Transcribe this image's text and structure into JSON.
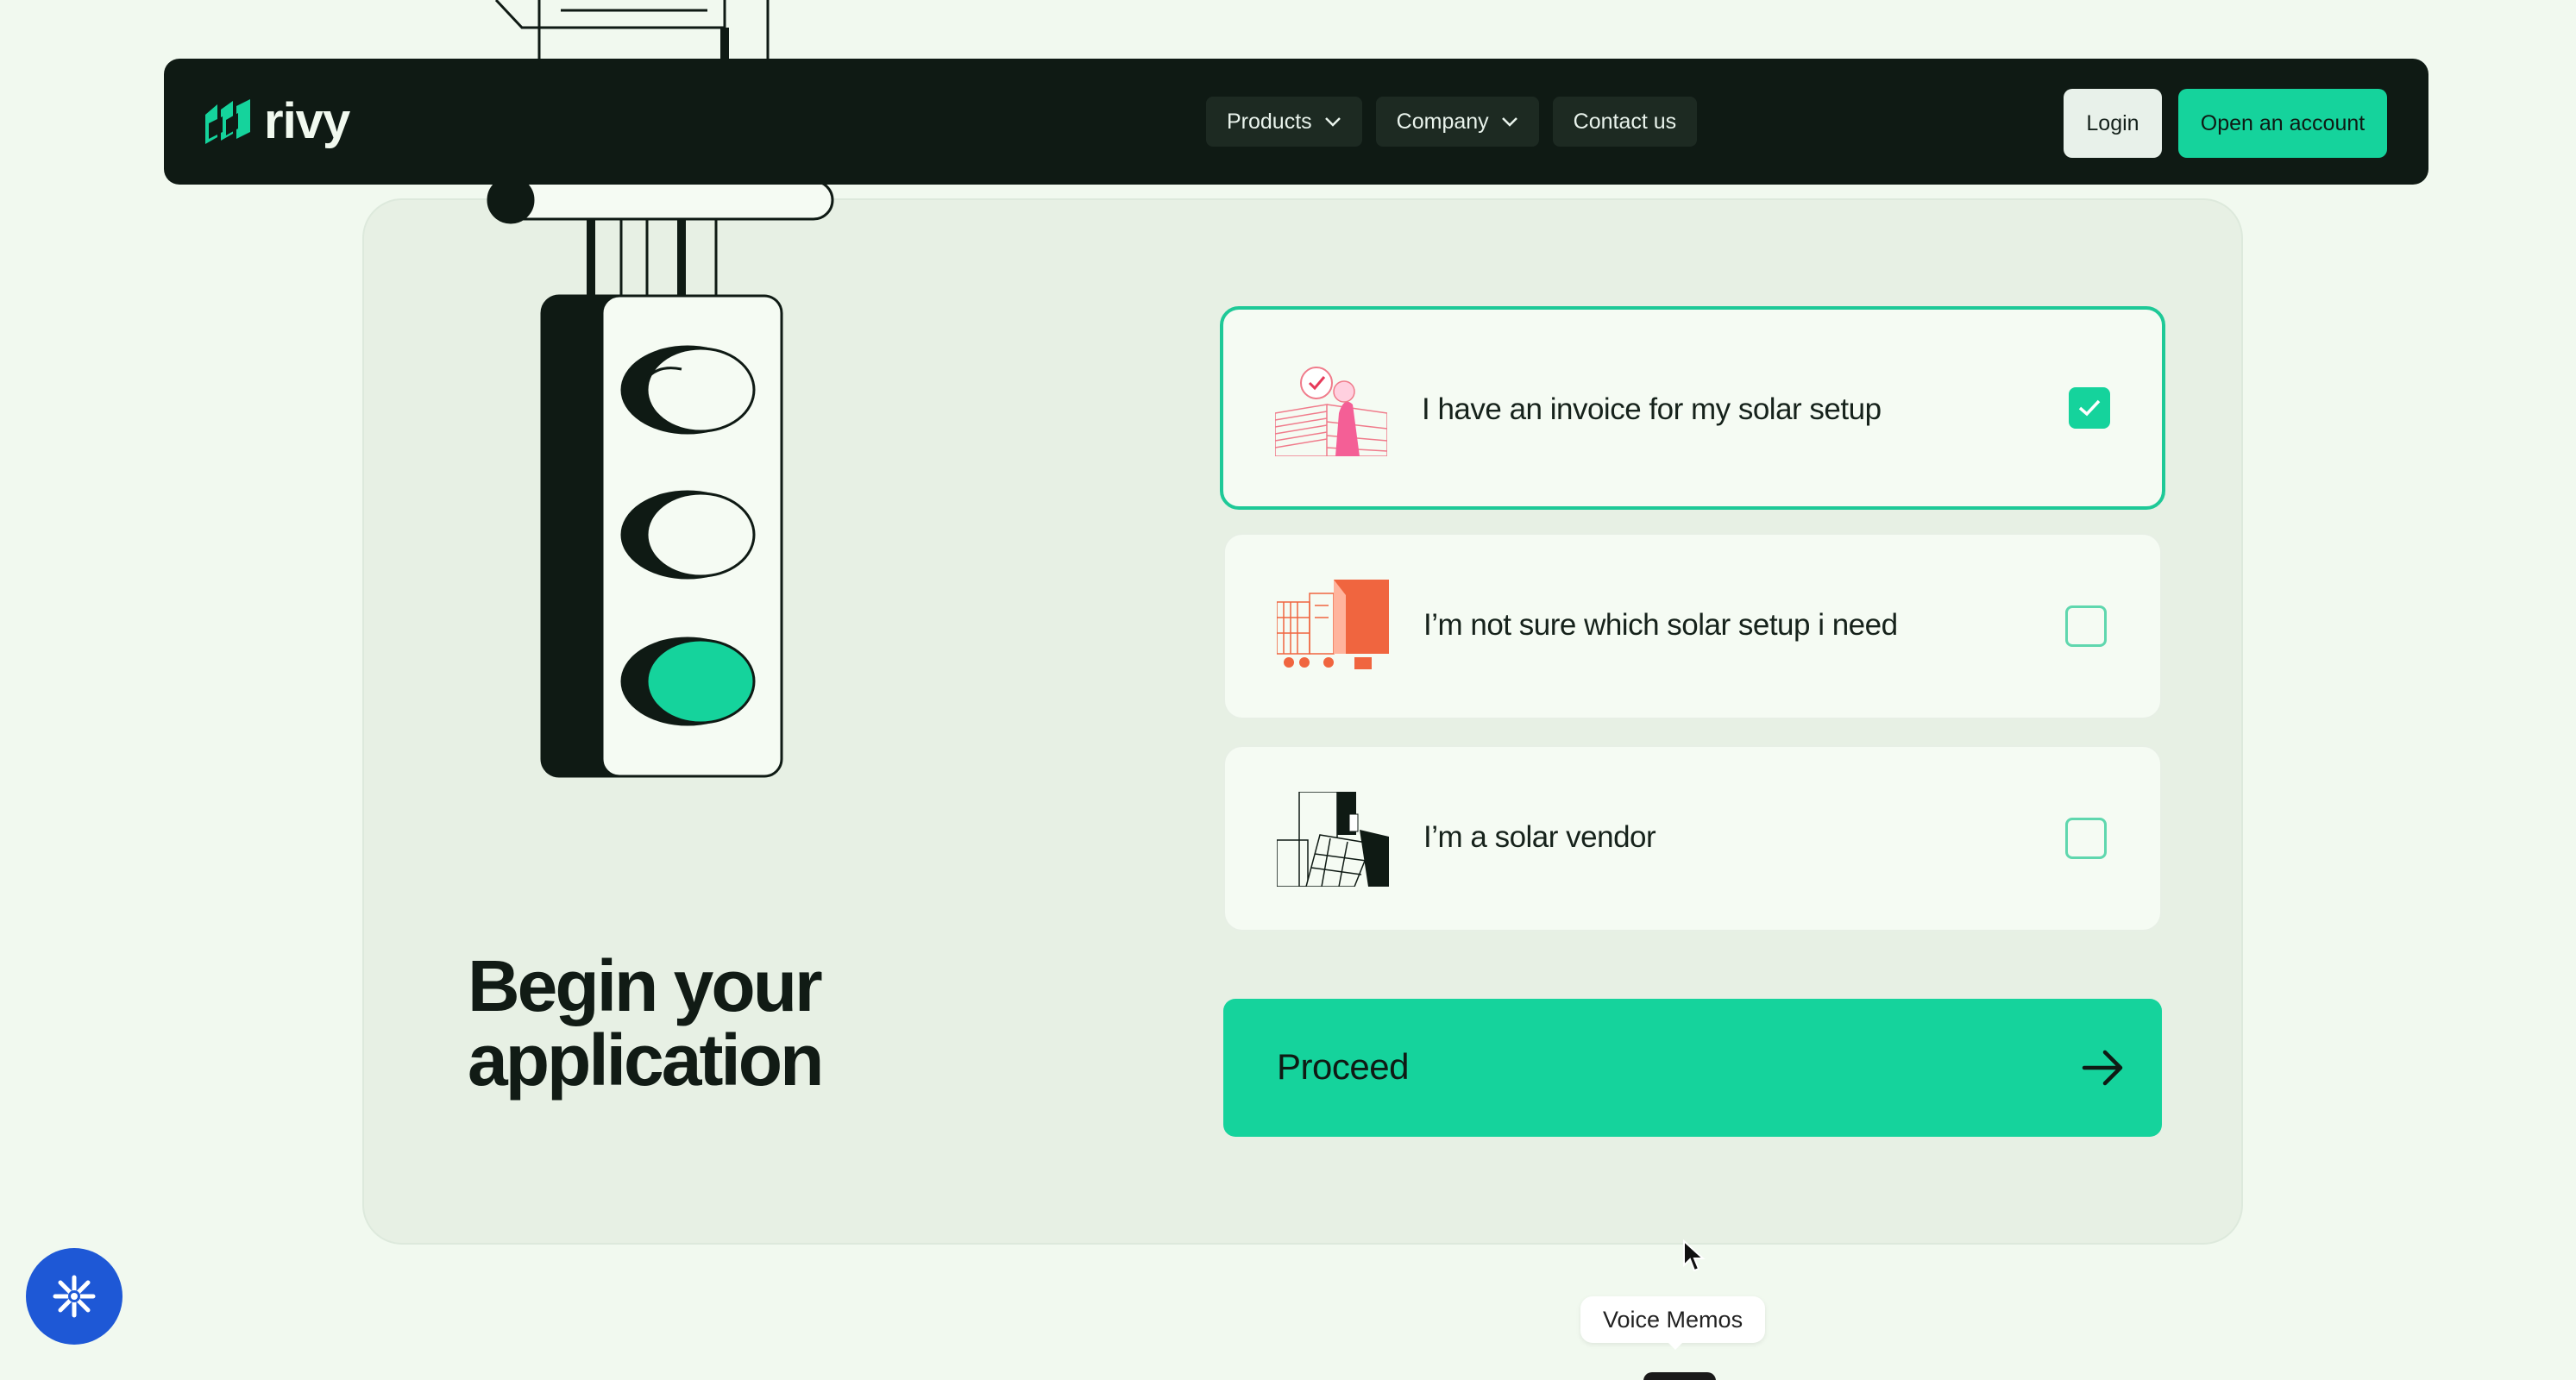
{
  "nav": {
    "brand": "rivy",
    "links": [
      {
        "label": "Products",
        "has_dropdown": true
      },
      {
        "label": "Company",
        "has_dropdown": true
      },
      {
        "label": "Contact us",
        "has_dropdown": false
      }
    ],
    "login_label": "Login",
    "open_account_label": "Open an account"
  },
  "hero": {
    "headline_line1": "Begin your",
    "headline_line2": "application"
  },
  "options": [
    {
      "label": "I have an invoice for my solar setup",
      "checked": true,
      "icon": "solar-invoice-illustration"
    },
    {
      "label": "I’m not sure which solar setup i need",
      "checked": false,
      "icon": "solar-houses-illustration"
    },
    {
      "label": "I’m a solar vendor",
      "checked": false,
      "icon": "solar-vendor-illustration"
    }
  ],
  "proceed": {
    "label": "Proceed",
    "icon": "arrow-right-icon"
  },
  "fab": {
    "icon": "asterisk-icon"
  },
  "tooltip": {
    "label": "Voice Memos"
  },
  "colors": {
    "accent": "#15d39c",
    "nav_bg": "#0f1a14",
    "page_bg": "#f1f9ef",
    "card_bg": "#e7f0e4",
    "fab_bg": "#1e58d6"
  }
}
